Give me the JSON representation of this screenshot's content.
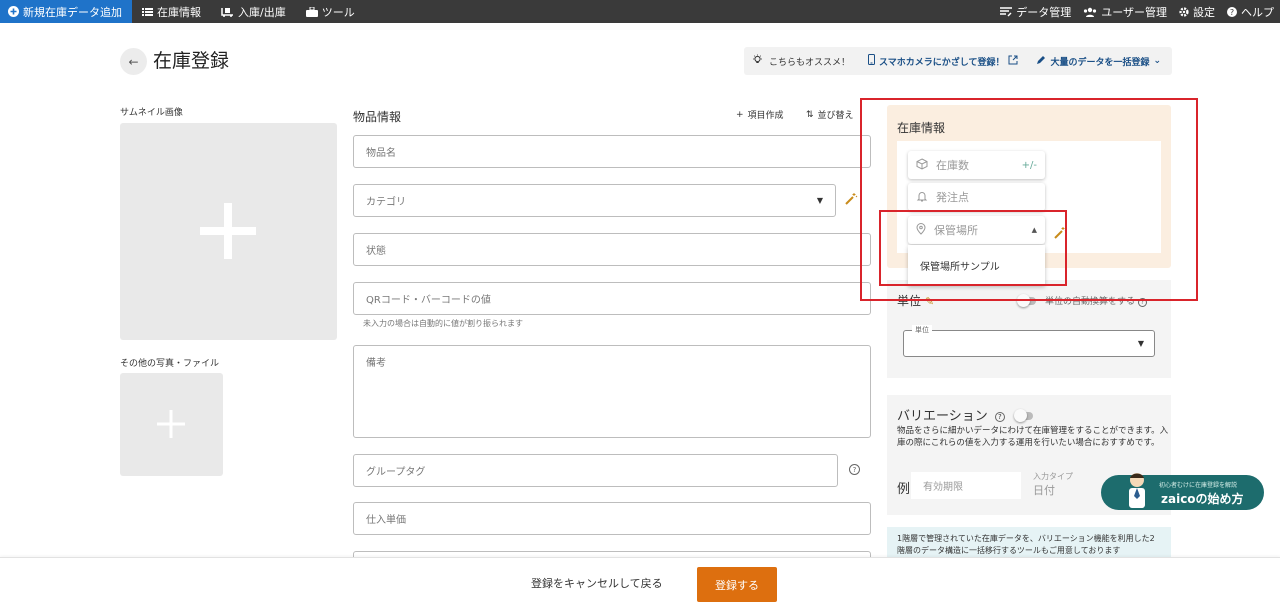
{
  "nav": {
    "new_item": "新規在庫データ追加",
    "inventory": "在庫情報",
    "inout": "入庫/出庫",
    "tools": "ツール",
    "data_mgmt": "データ管理",
    "user_mgmt": "ユーザー管理",
    "settings": "設定",
    "help": "ヘルプ"
  },
  "header": {
    "title": "在庫登録",
    "promo_label": "こちらもオススメ！",
    "promo_camera": "スマホカメラにかざして登録！",
    "promo_bulk": "大量のデータを一括登録"
  },
  "left": {
    "thumbnail_label": "サムネイル画像",
    "other_label": "その他の写真・ファイル"
  },
  "item": {
    "section_title": "物品情報",
    "add_field": "項目作成",
    "reorder": "並び替え",
    "name_ph": "物品名",
    "category_ph": "カテゴリ",
    "state_ph": "状態",
    "code_ph": "QRコード・バーコードの値",
    "code_hint": "未入力の場合は自動的に値が割り振られます",
    "memo_ph": "備考",
    "group_tag_ph": "グループタグ",
    "unit_price_ph": "仕入単価"
  },
  "stock": {
    "title": "在庫情報",
    "quantity_ph": "在庫数",
    "quantity_trail": "+/-",
    "reorder_point_ph": "発注点",
    "location_ph": "保管場所",
    "location_option": "保管場所サンプル"
  },
  "unit": {
    "title": "単位",
    "auto_convert": "単位の自動換算をする",
    "select_legend": "単位"
  },
  "variation": {
    "title": "バリエーション",
    "description": "物品をさらに細かいデータにわけて在庫管理をすることができます。入庫の際にこれらの値を入力する運用を行いたい場合におすすめです。",
    "example_label": "例",
    "example_value": "有効期限",
    "input_type_label": "入力タイプ",
    "input_type_value": "日付"
  },
  "info": {
    "text": "1階層で管理されていた在庫データを、バリエーション機能を利用した2階層のデータ構造に一括移行するツールもご用意しております"
  },
  "help_badge": {
    "sub": "初心者むけに在庫登録を解説",
    "main": "zaicoの始め方"
  },
  "footer": {
    "cancel": "登録をキャンセルして戻る",
    "submit": "登録する"
  },
  "colors": {
    "accent_orange": "#dd6f0f",
    "nav_blue": "#1f73c9",
    "highlight_red": "#d9242b",
    "stock_panel": "#fbeee0"
  }
}
